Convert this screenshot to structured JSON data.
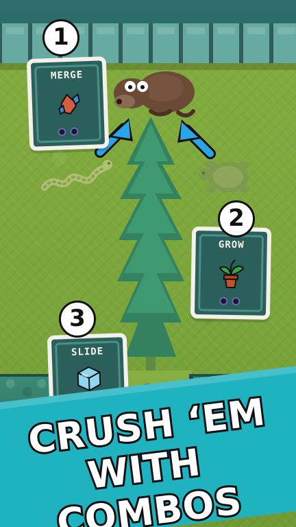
{
  "cards": [
    {
      "id": "merge",
      "number": "1",
      "label": "MERGE",
      "icon": "rock-merge-icon"
    },
    {
      "id": "grow",
      "number": "2",
      "label": "GROW",
      "icon": "potted-plant-icon"
    },
    {
      "id": "slide",
      "number": "3",
      "label": "SLIDE",
      "icon": "ice-cube-icon"
    }
  ],
  "slogan": {
    "line1": "CRUSH ‘EM",
    "line2": "WITH COMBOS"
  },
  "colors": {
    "card_bg": "#2b5f5b",
    "card_border": "#f4f1ea",
    "banner": "#1fb3c0",
    "grass": "#7fa83e",
    "arrow": "#2aa5e6"
  },
  "sprites": {
    "enemy": "bear-enemy-icon",
    "player": "player-character-icon",
    "tree": "tall-tree-icon",
    "snake": "snake-ghost-icon",
    "turtle": "turtle-ghost-icon"
  }
}
